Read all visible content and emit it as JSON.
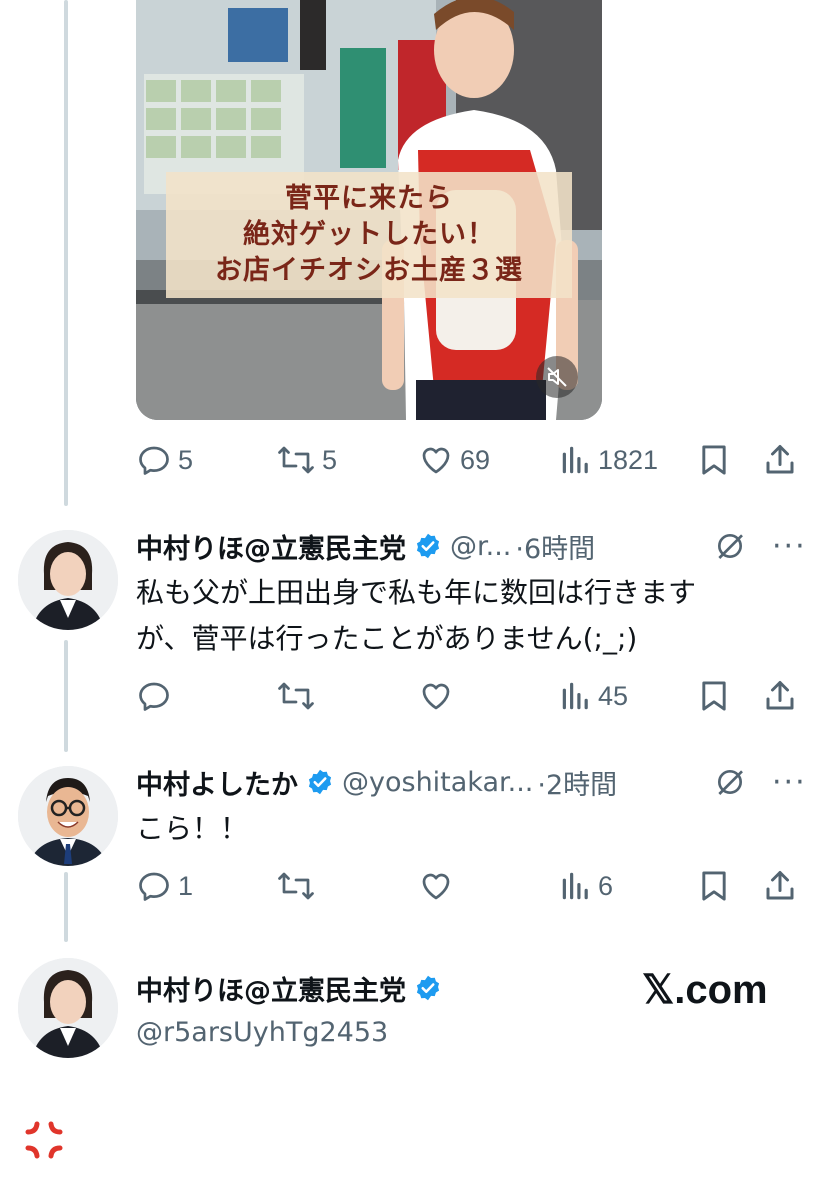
{
  "video": {
    "caption_lines": [
      "菅平に来たら",
      "絶対ゲットしたい！",
      "お店イチオシお土産３選"
    ],
    "mute_icon": "speaker-muted-icon"
  },
  "video_tweet_actions": {
    "replies": "5",
    "reposts": "5",
    "likes": "69",
    "views": "1821"
  },
  "reply1": {
    "name": "中村りほ@立憲民主党",
    "handle": "@r...",
    "time": "·6時間",
    "text_line1": "私も父が上田出身で私も年に数回は行きます",
    "text_line2": "が、菅平は行ったことがありません(;_;)",
    "actions": {
      "replies": "",
      "reposts": "",
      "likes": "",
      "views": "45"
    }
  },
  "reply2": {
    "name": "中村よしたか",
    "handle": "@yoshitakar...",
    "time": "·2時間",
    "text": "こら！！",
    "actions": {
      "replies": "1",
      "reposts": "",
      "likes": "",
      "views": "6"
    }
  },
  "profile_card": {
    "name": "中村りほ@立憲民主党",
    "handle": "@r5arsUyhTg2453"
  },
  "watermark": "𝕏.com",
  "colors": {
    "accent": "#1d9bf0",
    "muted": "#536471",
    "text": "#0f1419",
    "thread": "#cfd9de",
    "anger": "#e0352b"
  }
}
